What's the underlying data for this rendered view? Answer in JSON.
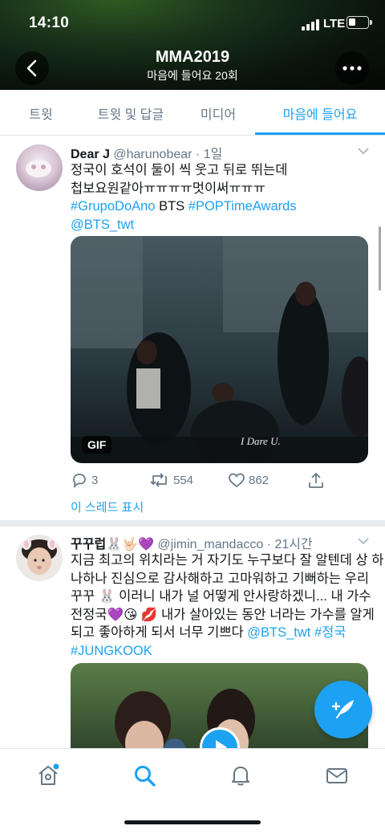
{
  "status": {
    "time": "14:10",
    "network": "LTE"
  },
  "header": {
    "title": "MMA2019",
    "subtitle": "마음에 들어요 20회",
    "back_icon": "chevron-left-icon",
    "more_icon": "more-dots-icon"
  },
  "tabs": [
    {
      "label": "트윗"
    },
    {
      "label": "트윗 및 답글"
    },
    {
      "label": "미디어"
    },
    {
      "label": "마음에 들어요",
      "active": true
    }
  ],
  "tweets": [
    {
      "name": "Dear J",
      "handle": "@harunobear",
      "time": "1일",
      "lines": [
        "정국이 호석이 둘이 씩 웃고 뒤로 뛰는데",
        "첩보요원같아ㅠㅠㅠㅠ멋이써ㅠㅠㅠ"
      ],
      "line3": {
        "tag1": "#GrupoDoAno",
        "mid": " BTS ",
        "tag2": "#POPTimeAwards"
      },
      "line4": "@BTS_twt",
      "media": {
        "badge": "GIF",
        "watermark": "I Dare U."
      },
      "stats": {
        "replies": "3",
        "retweets": "554",
        "likes": "862"
      },
      "thread_link": "이 스레드 표시"
    },
    {
      "name": "꾸꾸럽🐰🤟🏻💜",
      "handle": "@jimin_mandacco",
      "time": "21시간",
      "lines": [
        "지금 최고의 위치라는 거 자기도 누구보다 잘 알텐데 상 하",
        "나하나 진심으로 감사해하고 고마워하고 기뻐하는 우리",
        "꾸꾸 🐰 이러니 내가 널 어떻게 안사랑하겠니... 내 가수",
        "전정국💜😘 💋 내가 살아있는 동안 너라는 가수를 알게"
      ],
      "line5": {
        "text": "되고 좋아하게 되서 너무 기쁘다 ",
        "mention": "@BTS_twt",
        "tag": " #정국"
      },
      "line6": "#JUNGKOOK"
    }
  ],
  "colors": {
    "accent": "#1da1f2",
    "muted": "#657786"
  },
  "bottom_nav": [
    "home-icon",
    "search-icon",
    "notifications-icon",
    "messages-icon"
  ],
  "compose_icon": "compose-tweet-icon"
}
